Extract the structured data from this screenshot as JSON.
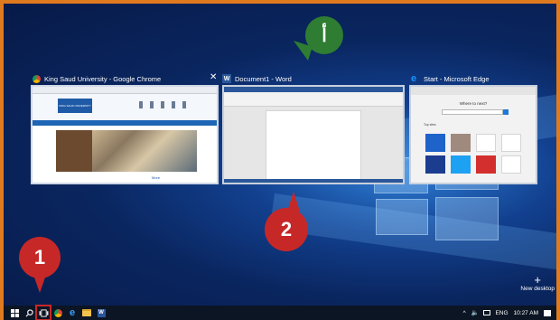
{
  "windows": [
    {
      "title": "King Saud University - Google Chrome",
      "icon": "chrome-icon"
    },
    {
      "title": "Document1 - Word",
      "icon": "word-icon"
    },
    {
      "title": "Start - Microsoft Edge",
      "icon": "edge-icon"
    }
  ],
  "chrome_page": {
    "banner_text": "KING SAUD UNIVERSITY",
    "more_label": "More"
  },
  "edge_page": {
    "prompt": "Where to next?",
    "section_label": "Top sites"
  },
  "annotations": {
    "badge_1": "1",
    "badge_2": "2",
    "badge_alef": "أ"
  },
  "new_desktop_label": "New desktop",
  "tray": {
    "language": "ENG",
    "time": "10:27 AM"
  },
  "colors": {
    "frame": "#e07a1f",
    "badge_red": "#c62828",
    "badge_green": "#2e7d32",
    "taskbar": "#0c1524"
  }
}
